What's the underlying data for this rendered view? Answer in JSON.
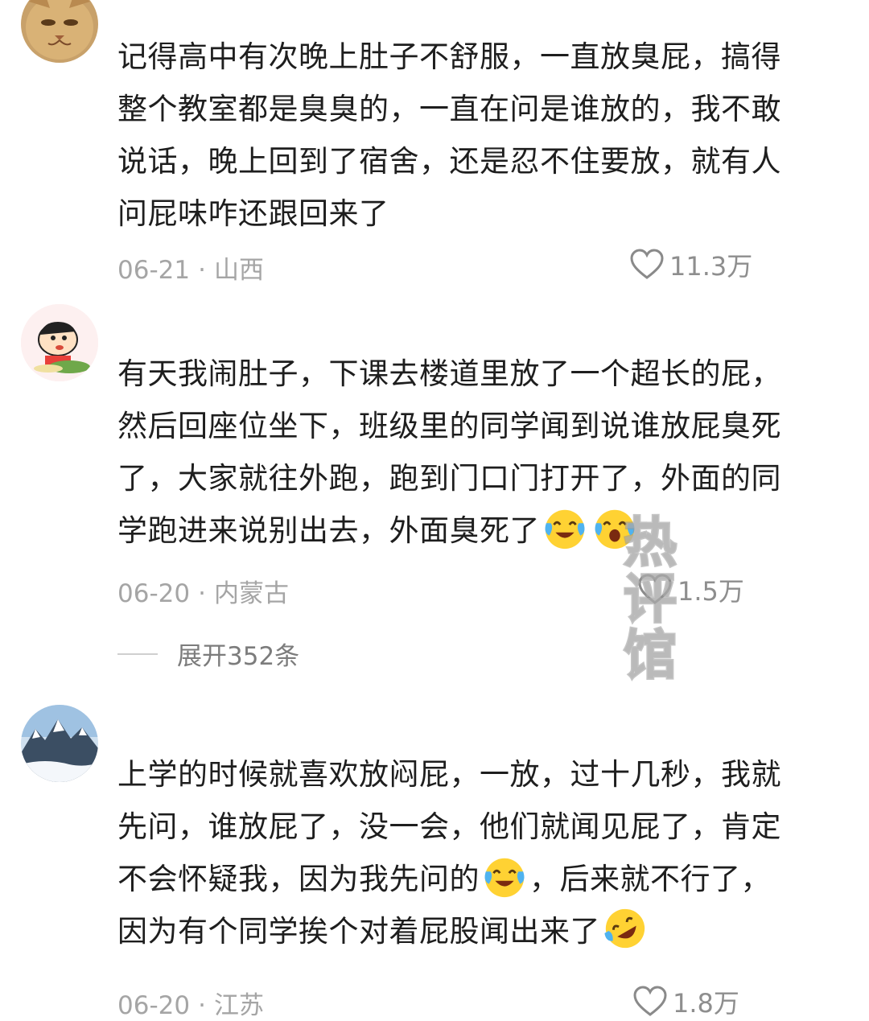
{
  "comments": [
    {
      "lines": [
        "记得高中有次晚上肚子不舒服，一直放臭屁，搞得",
        "整个教室都是臭臭的，一直在问是谁放的，我不敢",
        "说话，晚上回到了宿舍，还是忍不住要放，就有人",
        "问屁味咋还跟回来了"
      ],
      "date": "06-21",
      "location": "山西",
      "likes": "11.3万"
    },
    {
      "lines": [
        "有天我闹肚子，下课去楼道里放了一个超长的屁，",
        "然后回座位坐下，班级里的同学闻到说谁放屁臭死",
        "了，大家就往外跑，跑到门口门打开了，外面的同",
        "学跑进来说别出去，外面臭死了"
      ],
      "date": "06-20",
      "location": "内蒙古",
      "likes": "1.5万",
      "expand_label": "展开352条"
    },
    {
      "lines": [
        "上学的时候就喜欢放闷屁，一放，过十几秒，我就",
        "先问，谁放屁了，没一会，他们就闻见屁了，肯定",
        "不会怀疑我，因为我先问的",
        "，后来就不行了，",
        "因为有个同学挨个对着屁股闻出来了"
      ],
      "date": "06-20",
      "location": "江苏",
      "likes": "1.8万"
    }
  ],
  "separator": "·",
  "watermark": [
    "热",
    "评",
    "馆"
  ],
  "icons": {
    "like": "heart-outline-icon",
    "avatar1": "cat-avatar",
    "avatar2": "cartoon-boy-avatar",
    "avatar3": "mountain-avatar",
    "emoji_cry": "crying-laughing-emoji",
    "emoji_rofl": "rolling-laughing-emoji"
  },
  "colors": {
    "text": "#1e1e1e",
    "meta": "#a5a5a5",
    "like": "#8e8e8e",
    "emoji_yellow": "#ffd233"
  }
}
